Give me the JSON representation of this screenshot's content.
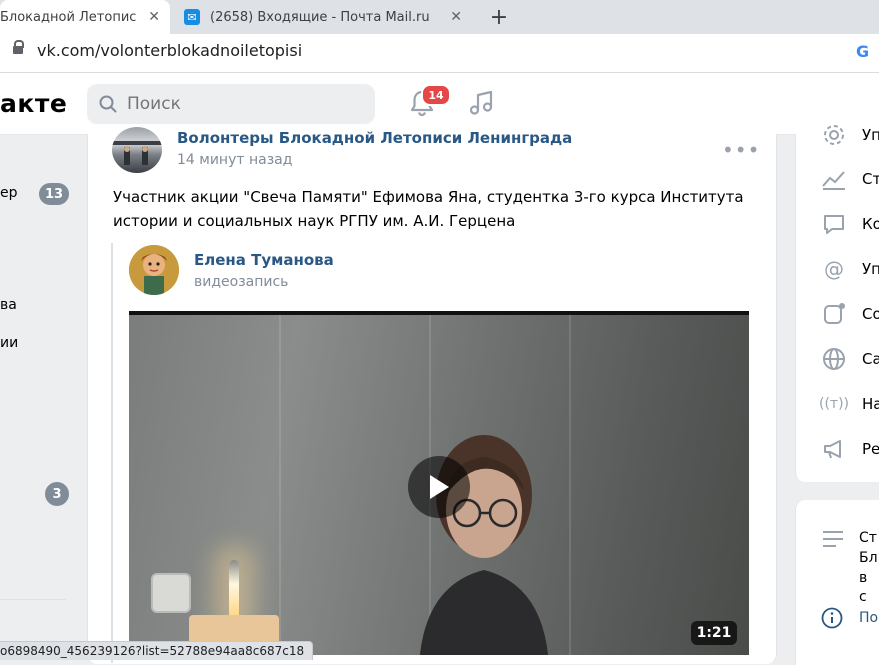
{
  "browser": {
    "tabs": [
      {
        "title": "Блокадной Летописи Ленинграда",
        "close": "✕"
      },
      {
        "title": "(2658) Входящие - Почта Mail.ru",
        "close": "✕"
      }
    ],
    "new_tab": "+",
    "url": "vk.com/volonterblokadnoiletopisi",
    "status_url": "o6898490_456239126?list=52788e94aa8c687c18"
  },
  "header": {
    "logo": "акте",
    "search_placeholder": "Поиск",
    "notifications_count": "14"
  },
  "left_menu": [
    {
      "label": "ер",
      "count": "13"
    },
    {
      "label": "ва",
      "count": ""
    },
    {
      "label": "ии",
      "count": ""
    },
    {
      "label": "",
      "count": "3"
    }
  ],
  "post": {
    "author": "Волонтеры Блокадной Летописи Ленинграда",
    "time": "14 минут назад",
    "text": "Участник акции \"Свеча Памяти\" Ефимова Яна, студентка 3-го курса Института истории и социальных наук РГПУ им. А.И. Герцена",
    "repost": {
      "author": "Елена Туманова",
      "type": "видеозапись",
      "duration": "1:21"
    }
  },
  "right_menu": [
    {
      "icon": "gear-icon",
      "label": "Уп"
    },
    {
      "icon": "stats-icon",
      "label": "Ст"
    },
    {
      "icon": "comment-icon",
      "label": "Ко"
    },
    {
      "icon": "at-icon",
      "label": "Уп"
    },
    {
      "icon": "app-icon",
      "label": "Со"
    },
    {
      "icon": "globe-icon",
      "label": "Са"
    },
    {
      "icon": "broadcast-icon",
      "label": "На"
    },
    {
      "icon": "megaphone-icon",
      "label": "Ре"
    }
  ],
  "right_card": {
    "text_lines": [
      "Ст",
      "Бл",
      "в с"
    ],
    "link": "По"
  },
  "colors": {
    "vk_link": "#2a5885",
    "badge_red": "#e64646",
    "gray_text": "#818c99"
  }
}
